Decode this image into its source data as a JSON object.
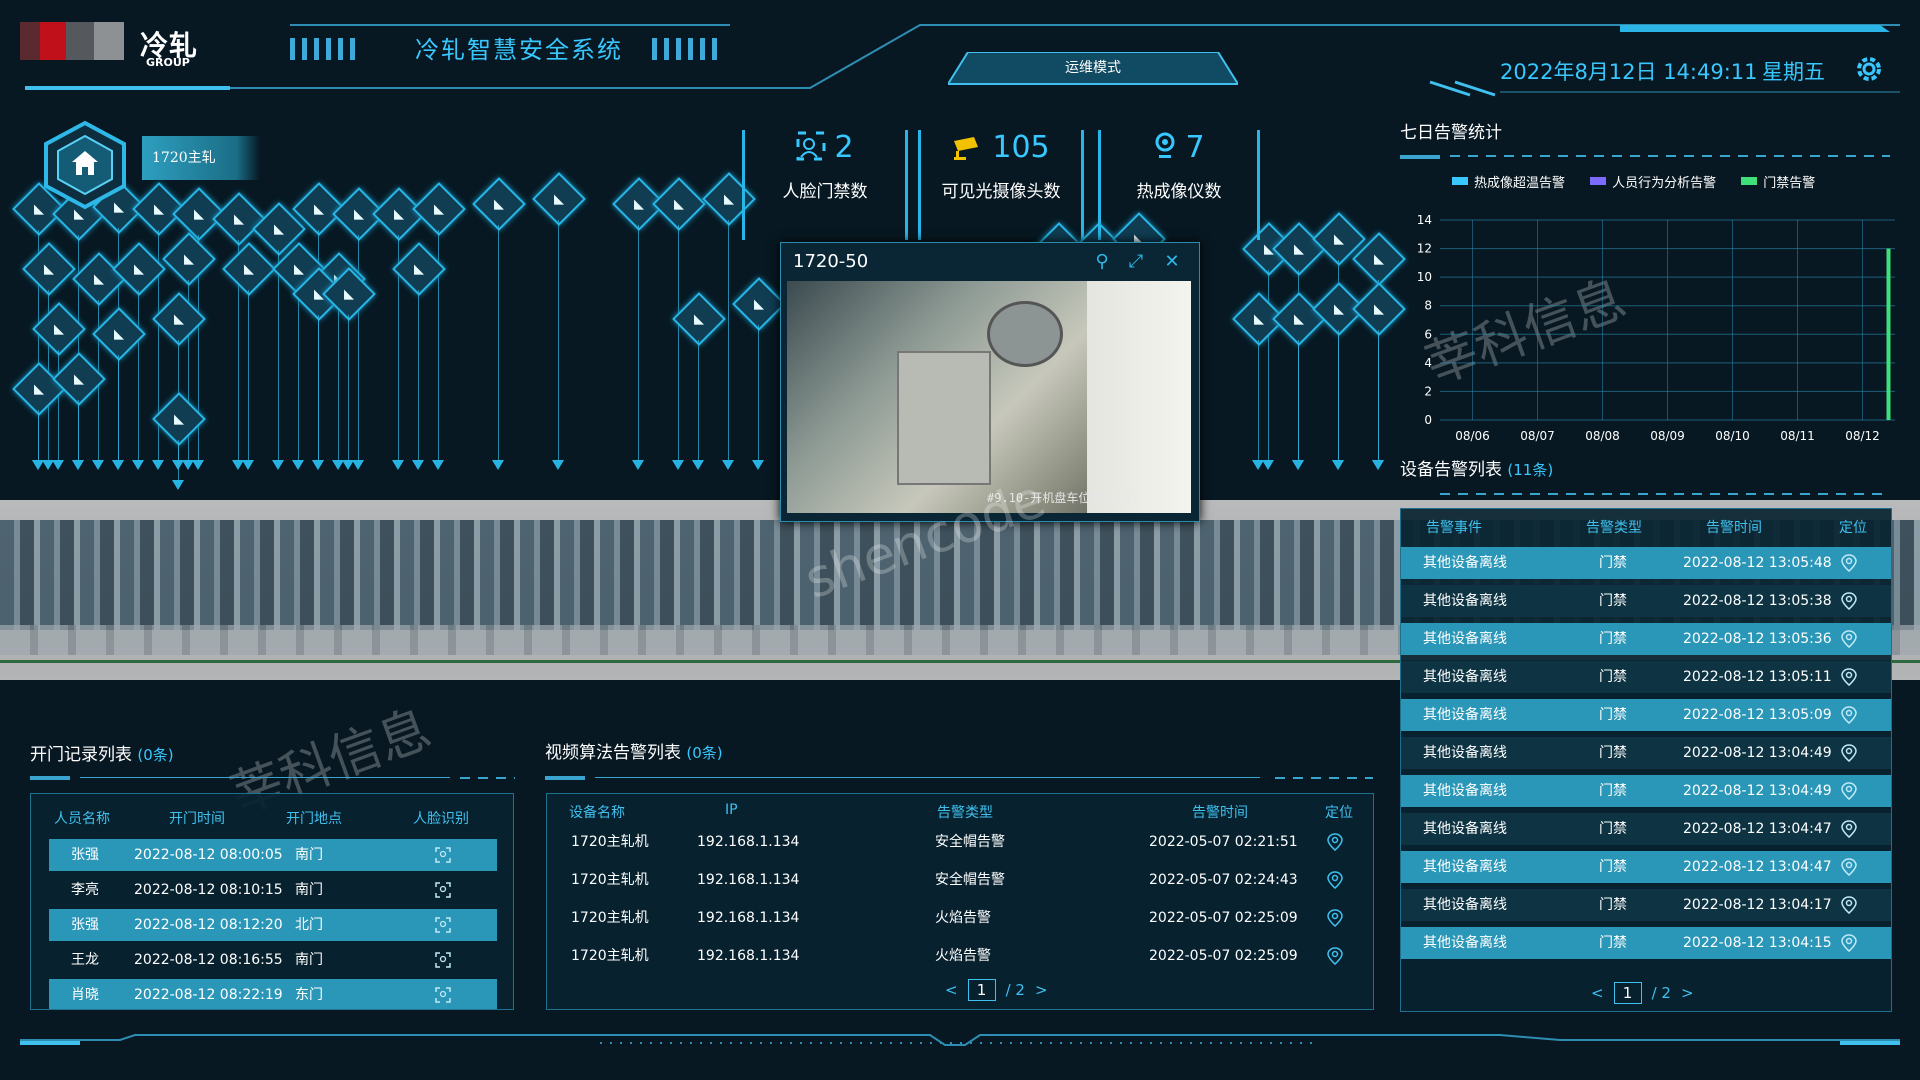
{
  "header": {
    "logo_text": "冷轧",
    "logo_sub": "GROUP",
    "system_title": "冷轧智慧安全系统",
    "mode_label": "运维模式",
    "datetime": "2022年8月12日 14:49:11",
    "weekday": "星期五"
  },
  "scene": {
    "host_label": "1720主轧",
    "stats": [
      {
        "value": "2",
        "label": "人脸门禁数",
        "icon": "face-id-icon"
      },
      {
        "value": "105",
        "label": "可见光摄像头数",
        "icon": "camera-icon"
      },
      {
        "value": "7",
        "label": "热成像仪数",
        "icon": "thermal-icon"
      }
    ],
    "popup": {
      "title": "1720-50",
      "video_caption": "#9.10-开机盘车位置-058"
    },
    "watermark_main": "shencode",
    "watermark_cn": "莘科信息"
  },
  "seven_day": {
    "title": "七日告警统计",
    "legend": [
      "热成像超温告警",
      "人员行为分析告警",
      "门禁告警"
    ]
  },
  "chart_data": {
    "type": "bar",
    "title": "七日告警统计",
    "categories": [
      "08/06",
      "08/07",
      "08/08",
      "08/09",
      "08/10",
      "08/11",
      "08/12"
    ],
    "series": [
      {
        "name": "热成像超温告警",
        "values": [
          0,
          0,
          0,
          0,
          0,
          0,
          0
        ],
        "color": "#38c7ff"
      },
      {
        "name": "人员行为分析告警",
        "values": [
          0,
          0,
          0,
          0,
          0,
          0,
          0
        ],
        "color": "#7b6cff"
      },
      {
        "name": "门禁告警",
        "values": [
          0,
          0,
          0,
          0,
          0,
          0,
          12
        ],
        "color": "#3fe07a"
      }
    ],
    "ylim": [
      0,
      14
    ],
    "yticks": [
      "0",
      "2",
      "4",
      "6",
      "8",
      "10",
      "12",
      "14"
    ],
    "grid": true,
    "legend_position": "top"
  },
  "device_alarm": {
    "title": "设备告警列表",
    "count": "(11条)",
    "headers": [
      "告警事件",
      "告警类型",
      "告警时间",
      "定位"
    ],
    "rows": [
      {
        "event": "其他设备离线",
        "type": "门禁",
        "time": "2022-08-12 13:05:48"
      },
      {
        "event": "其他设备离线",
        "type": "门禁",
        "time": "2022-08-12 13:05:38"
      },
      {
        "event": "其他设备离线",
        "type": "门禁",
        "time": "2022-08-12 13:05:36"
      },
      {
        "event": "其他设备离线",
        "type": "门禁",
        "time": "2022-08-12 13:05:11"
      },
      {
        "event": "其他设备离线",
        "type": "门禁",
        "time": "2022-08-12 13:05:09"
      },
      {
        "event": "其他设备离线",
        "type": "门禁",
        "time": "2022-08-12 13:04:49"
      },
      {
        "event": "其他设备离线",
        "type": "门禁",
        "time": "2022-08-12 13:04:49"
      },
      {
        "event": "其他设备离线",
        "type": "门禁",
        "time": "2022-08-12 13:04:47"
      },
      {
        "event": "其他设备离线",
        "type": "门禁",
        "time": "2022-08-12 13:04:47"
      },
      {
        "event": "其他设备离线",
        "type": "门禁",
        "time": "2022-08-12 13:04:17"
      },
      {
        "event": "其他设备离线",
        "type": "门禁",
        "time": "2022-08-12 13:04:15"
      }
    ],
    "pager": {
      "current": "1",
      "total": "/ 2"
    }
  },
  "door_records": {
    "title": "开门记录列表",
    "count": "(0条)",
    "headers": [
      "人员名称",
      "开门时间",
      "开门地点",
      "人脸识别"
    ],
    "rows": [
      {
        "name": "张强",
        "time": "2022-08-12 08:00:05",
        "place": "南门"
      },
      {
        "name": "李亮",
        "time": "2022-08-12 08:10:15",
        "place": "南门"
      },
      {
        "name": "张强",
        "time": "2022-08-12 08:12:20",
        "place": "北门"
      },
      {
        "name": "王龙",
        "time": "2022-08-12 08:16:55",
        "place": "南门"
      },
      {
        "name": "肖晓",
        "time": "2022-08-12 08:22:19",
        "place": "东门"
      }
    ]
  },
  "video_alarm": {
    "title": "视频算法告警列表",
    "count": "(0条)",
    "headers": [
      "设备名称",
      "IP",
      "告警类型",
      "告警时间",
      "定位"
    ],
    "rows": [
      {
        "device": "1720主轧机",
        "ip": "192.168.1.134",
        "type": "安全帽告警",
        "time": "2022-05-07 02:21:51"
      },
      {
        "device": "1720主轧机",
        "ip": "192.168.1.134",
        "type": "安全帽告警",
        "time": "2022-05-07 02:24:43"
      },
      {
        "device": "1720主轧机",
        "ip": "192.168.1.134",
        "type": "火焰告警",
        "time": "2022-05-07 02:25:09"
      },
      {
        "device": "1720主轧机",
        "ip": "192.168.1.134",
        "type": "火焰告警",
        "time": "2022-05-07 02:25:09"
      }
    ],
    "pager": {
      "current": "1",
      "total": "/ 2"
    }
  }
}
